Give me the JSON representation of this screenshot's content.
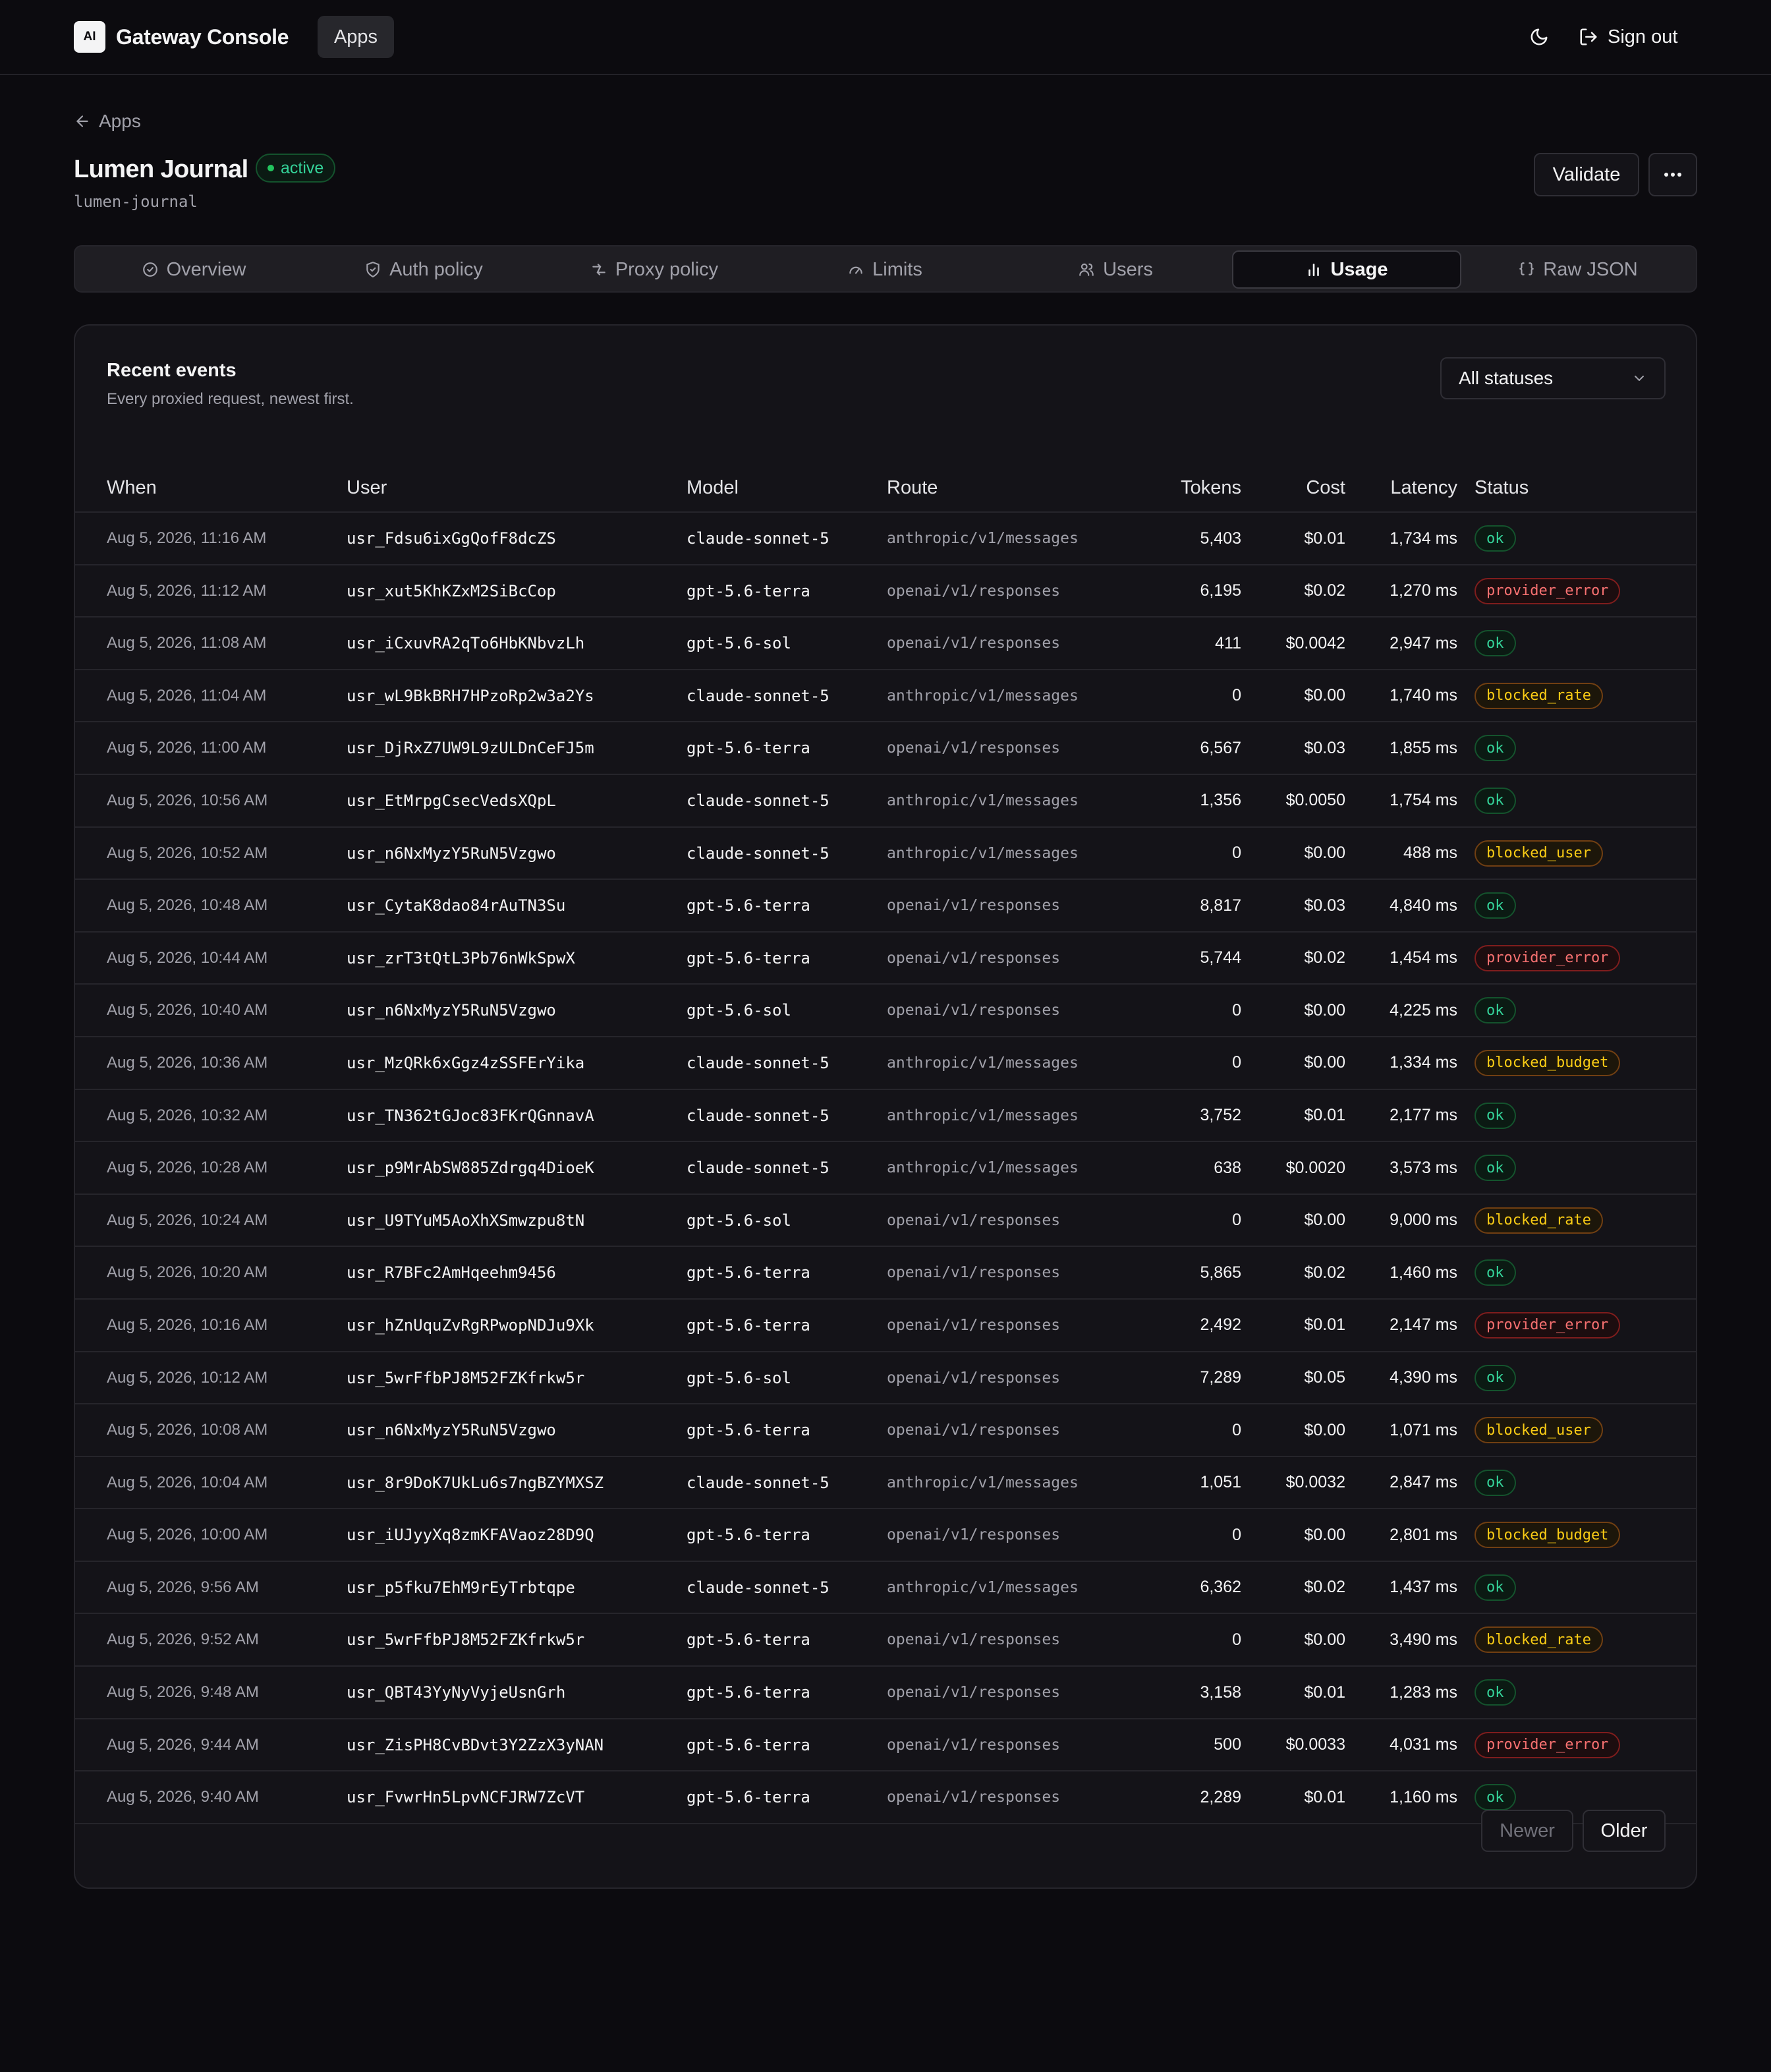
{
  "header": {
    "logo_text": "AI",
    "brand": "Gateway Console",
    "nav_apps": "Apps",
    "theme_icon": "moon-icon",
    "sign_out": "Sign out"
  },
  "breadcrumb": {
    "back_label": "Apps"
  },
  "app": {
    "name": "Lumen Journal",
    "status": "active",
    "slug": "lumen-journal",
    "validate_label": "Validate"
  },
  "tabs": [
    {
      "label": "Overview",
      "icon": "check-circle-icon",
      "active": false
    },
    {
      "label": "Auth policy",
      "icon": "shield-icon",
      "active": false
    },
    {
      "label": "Proxy policy",
      "icon": "route-icon",
      "active": false
    },
    {
      "label": "Limits",
      "icon": "gauge-icon",
      "active": false
    },
    {
      "label": "Users",
      "icon": "users-icon",
      "active": false
    },
    {
      "label": "Usage",
      "icon": "bar-chart-icon",
      "active": true
    },
    {
      "label": "Raw JSON",
      "icon": "braces-icon",
      "active": false
    }
  ],
  "events": {
    "title": "Recent events",
    "subtitle": "Every proxied request, newest first.",
    "filter_value": "All statuses",
    "columns": {
      "when": "When",
      "user": "User",
      "model": "Model",
      "route": "Route",
      "tokens": "Tokens",
      "cost": "Cost",
      "latency": "Latency",
      "status": "Status"
    },
    "rows": [
      {
        "when": "Aug 5, 2026, 11:16 AM",
        "user": "usr_Fdsu6ixGgQofF8dcZS",
        "model": "claude-sonnet-5",
        "route": "anthropic/v1/messages",
        "tokens": "5,403",
        "cost": "$0.01",
        "latency": "1,734 ms",
        "status": "ok"
      },
      {
        "when": "Aug 5, 2026, 11:12 AM",
        "user": "usr_xut5KhKZxM2SiBcCop",
        "model": "gpt-5.6-terra",
        "route": "openai/v1/responses",
        "tokens": "6,195",
        "cost": "$0.02",
        "latency": "1,270 ms",
        "status": "provider_error"
      },
      {
        "when": "Aug 5, 2026, 11:08 AM",
        "user": "usr_iCxuvRA2qTo6HbKNbvzLh",
        "model": "gpt-5.6-sol",
        "route": "openai/v1/responses",
        "tokens": "411",
        "cost": "$0.0042",
        "latency": "2,947 ms",
        "status": "ok"
      },
      {
        "when": "Aug 5, 2026, 11:04 AM",
        "user": "usr_wL9BkBRH7HPzoRp2w3a2Ys",
        "model": "claude-sonnet-5",
        "route": "anthropic/v1/messages",
        "tokens": "0",
        "cost": "$0.00",
        "latency": "1,740 ms",
        "status": "blocked_rate"
      },
      {
        "when": "Aug 5, 2026, 11:00 AM",
        "user": "usr_DjRxZ7UW9L9zULDnCeFJ5m",
        "model": "gpt-5.6-terra",
        "route": "openai/v1/responses",
        "tokens": "6,567",
        "cost": "$0.03",
        "latency": "1,855 ms",
        "status": "ok"
      },
      {
        "when": "Aug 5, 2026, 10:56 AM",
        "user": "usr_EtMrpgCsecVedsXQpL",
        "model": "claude-sonnet-5",
        "route": "anthropic/v1/messages",
        "tokens": "1,356",
        "cost": "$0.0050",
        "latency": "1,754 ms",
        "status": "ok"
      },
      {
        "when": "Aug 5, 2026, 10:52 AM",
        "user": "usr_n6NxMyzY5RuN5Vzgwo",
        "model": "claude-sonnet-5",
        "route": "anthropic/v1/messages",
        "tokens": "0",
        "cost": "$0.00",
        "latency": "488 ms",
        "status": "blocked_user"
      },
      {
        "when": "Aug 5, 2026, 10:48 AM",
        "user": "usr_CytaK8dao84rAuTN3Su",
        "model": "gpt-5.6-terra",
        "route": "openai/v1/responses",
        "tokens": "8,817",
        "cost": "$0.03",
        "latency": "4,840 ms",
        "status": "ok"
      },
      {
        "when": "Aug 5, 2026, 10:44 AM",
        "user": "usr_zrT3tQtL3Pb76nWkSpwX",
        "model": "gpt-5.6-terra",
        "route": "openai/v1/responses",
        "tokens": "5,744",
        "cost": "$0.02",
        "latency": "1,454 ms",
        "status": "provider_error"
      },
      {
        "when": "Aug 5, 2026, 10:40 AM",
        "user": "usr_n6NxMyzY5RuN5Vzgwo",
        "model": "gpt-5.6-sol",
        "route": "openai/v1/responses",
        "tokens": "0",
        "cost": "$0.00",
        "latency": "4,225 ms",
        "status": "ok"
      },
      {
        "when": "Aug 5, 2026, 10:36 AM",
        "user": "usr_MzQRk6xGgz4zSSFErYika",
        "model": "claude-sonnet-5",
        "route": "anthropic/v1/messages",
        "tokens": "0",
        "cost": "$0.00",
        "latency": "1,334 ms",
        "status": "blocked_budget"
      },
      {
        "when": "Aug 5, 2026, 10:32 AM",
        "user": "usr_TN362tGJoc83FKrQGnnavA",
        "model": "claude-sonnet-5",
        "route": "anthropic/v1/messages",
        "tokens": "3,752",
        "cost": "$0.01",
        "latency": "2,177 ms",
        "status": "ok"
      },
      {
        "when": "Aug 5, 2026, 10:28 AM",
        "user": "usr_p9MrAbSW885Zdrgq4DioeK",
        "model": "claude-sonnet-5",
        "route": "anthropic/v1/messages",
        "tokens": "638",
        "cost": "$0.0020",
        "latency": "3,573 ms",
        "status": "ok"
      },
      {
        "when": "Aug 5, 2026, 10:24 AM",
        "user": "usr_U9TYuM5AoXhXSmwzpu8tN",
        "model": "gpt-5.6-sol",
        "route": "openai/v1/responses",
        "tokens": "0",
        "cost": "$0.00",
        "latency": "9,000 ms",
        "status": "blocked_rate"
      },
      {
        "when": "Aug 5, 2026, 10:20 AM",
        "user": "usr_R7BFc2AmHqeehm9456",
        "model": "gpt-5.6-terra",
        "route": "openai/v1/responses",
        "tokens": "5,865",
        "cost": "$0.02",
        "latency": "1,460 ms",
        "status": "ok"
      },
      {
        "when": "Aug 5, 2026, 10:16 AM",
        "user": "usr_hZnUquZvRgRPwopNDJu9Xk",
        "model": "gpt-5.6-terra",
        "route": "openai/v1/responses",
        "tokens": "2,492",
        "cost": "$0.01",
        "latency": "2,147 ms",
        "status": "provider_error"
      },
      {
        "when": "Aug 5, 2026, 10:12 AM",
        "user": "usr_5wrFfbPJ8M52FZKfrkw5r",
        "model": "gpt-5.6-sol",
        "route": "openai/v1/responses",
        "tokens": "7,289",
        "cost": "$0.05",
        "latency": "4,390 ms",
        "status": "ok"
      },
      {
        "when": "Aug 5, 2026, 10:08 AM",
        "user": "usr_n6NxMyzY5RuN5Vzgwo",
        "model": "gpt-5.6-terra",
        "route": "openai/v1/responses",
        "tokens": "0",
        "cost": "$0.00",
        "latency": "1,071 ms",
        "status": "blocked_user"
      },
      {
        "when": "Aug 5, 2026, 10:04 AM",
        "user": "usr_8r9DoK7UkLu6s7ngBZYMXSZ",
        "model": "claude-sonnet-5",
        "route": "anthropic/v1/messages",
        "tokens": "1,051",
        "cost": "$0.0032",
        "latency": "2,847 ms",
        "status": "ok"
      },
      {
        "when": "Aug 5, 2026, 10:00 AM",
        "user": "usr_iUJyyXq8zmKFAVaoz28D9Q",
        "model": "gpt-5.6-terra",
        "route": "openai/v1/responses",
        "tokens": "0",
        "cost": "$0.00",
        "latency": "2,801 ms",
        "status": "blocked_budget"
      },
      {
        "when": "Aug 5, 2026, 9:56 AM",
        "user": "usr_p5fku7EhM9rEyTrbtqpe",
        "model": "claude-sonnet-5",
        "route": "anthropic/v1/messages",
        "tokens": "6,362",
        "cost": "$0.02",
        "latency": "1,437 ms",
        "status": "ok"
      },
      {
        "when": "Aug 5, 2026, 9:52 AM",
        "user": "usr_5wrFfbPJ8M52FZKfrkw5r",
        "model": "gpt-5.6-terra",
        "route": "openai/v1/responses",
        "tokens": "0",
        "cost": "$0.00",
        "latency": "3,490 ms",
        "status": "blocked_rate"
      },
      {
        "when": "Aug 5, 2026, 9:48 AM",
        "user": "usr_QBT43YyNyVyjeUsnGrh",
        "model": "gpt-5.6-terra",
        "route": "openai/v1/responses",
        "tokens": "3,158",
        "cost": "$0.01",
        "latency": "1,283 ms",
        "status": "ok"
      },
      {
        "when": "Aug 5, 2026, 9:44 AM",
        "user": "usr_ZisPH8CvBDvt3Y2ZzX3yNAN",
        "model": "gpt-5.6-terra",
        "route": "openai/v1/responses",
        "tokens": "500",
        "cost": "$0.0033",
        "latency": "4,031 ms",
        "status": "provider_error"
      },
      {
        "when": "Aug 5, 2026, 9:40 AM",
        "user": "usr_FvwrHn5LpvNCFJRW7ZcVT",
        "model": "gpt-5.6-terra",
        "route": "openai/v1/responses",
        "tokens": "2,289",
        "cost": "$0.01",
        "latency": "1,160 ms",
        "status": "ok"
      }
    ]
  },
  "pagination": {
    "newer": "Newer",
    "older": "Older"
  },
  "colors": {
    "background": "#0c0b0f",
    "card": "#141318",
    "ok": "#34d399",
    "error": "#f87171",
    "warning": "#facc15"
  }
}
